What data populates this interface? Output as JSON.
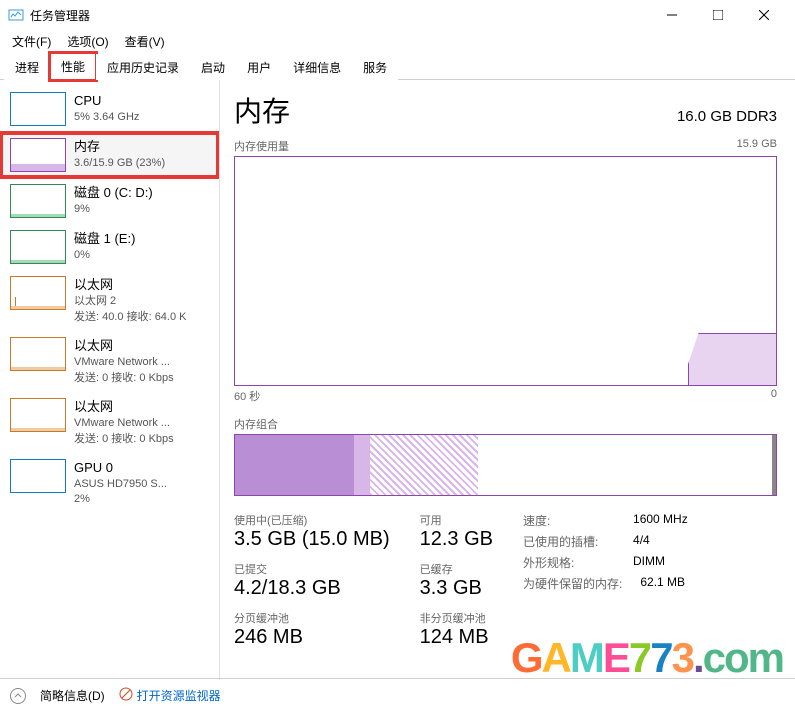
{
  "window": {
    "title": "任务管理器"
  },
  "menu": {
    "file": "文件(F)",
    "options": "选项(O)",
    "view": "查看(V)"
  },
  "tabs": [
    {
      "label": "进程"
    },
    {
      "label": "性能"
    },
    {
      "label": "应用历史记录"
    },
    {
      "label": "启动"
    },
    {
      "label": "用户"
    },
    {
      "label": "详细信息"
    },
    {
      "label": "服务"
    }
  ],
  "sidebar": [
    {
      "title": "CPU",
      "sub": "5% 3.64 GHz"
    },
    {
      "title": "内存",
      "sub": "3.6/15.9 GB (23%)"
    },
    {
      "title": "磁盘 0 (C: D:)",
      "sub": "9%"
    },
    {
      "title": "磁盘 1 (E:)",
      "sub": "0%"
    },
    {
      "title": "以太网",
      "sub": "以太网 2",
      "sub2": "发送: 40.0 接收: 64.0 K"
    },
    {
      "title": "以太网",
      "sub": "VMware Network ...",
      "sub2": "发送: 0 接收: 0 Kbps"
    },
    {
      "title": "以太网",
      "sub": "VMware Network ...",
      "sub2": "发送: 0 接收: 0 Kbps"
    },
    {
      "title": "GPU 0",
      "sub": "ASUS HD7950 S...",
      "sub2": "2%"
    }
  ],
  "main": {
    "title": "内存",
    "capacity": "16.0 GB DDR3",
    "usage_label": "内存使用量",
    "usage_max": "15.9 GB",
    "axis_left": "60 秒",
    "axis_right": "0",
    "comp_label": "内存组合"
  },
  "stats": {
    "in_use_label": "使用中(已压缩)",
    "in_use": "3.5 GB (15.0 MB)",
    "avail_label": "可用",
    "avail": "12.3 GB",
    "committed_label": "已提交",
    "committed": "4.2/18.3 GB",
    "cached_label": "已缓存",
    "cached": "3.3 GB",
    "paged_label": "分页缓冲池",
    "paged": "246 MB",
    "nonpaged_label": "非分页缓冲池",
    "nonpaged": "124 MB"
  },
  "details": {
    "speed_k": "速度:",
    "speed_v": "1600 MHz",
    "slots_k": "已使用的插槽:",
    "slots_v": "4/4",
    "form_k": "外形规格:",
    "form_v": "DIMM",
    "hw_k": "为硬件保留的内存:",
    "hw_v": "62.1 MB"
  },
  "bottom": {
    "brief": "简略信息(D)",
    "monitor": "打开资源监视器"
  },
  "chart_data": {
    "type": "area",
    "title": "内存使用量",
    "xlabel": "秒",
    "ylabel": "GB",
    "xlim": [
      60,
      0
    ],
    "ylim": [
      0,
      15.9
    ],
    "series": [
      {
        "name": "内存使用量",
        "x": [
          60,
          55,
          50,
          45,
          40,
          35,
          30,
          25,
          20,
          15,
          10,
          8,
          6,
          4,
          2,
          0
        ],
        "values": [
          0,
          0,
          0,
          0,
          0,
          0,
          0,
          0,
          0,
          0,
          0,
          2.0,
          3.5,
          3.5,
          3.5,
          3.5
        ]
      }
    ]
  }
}
